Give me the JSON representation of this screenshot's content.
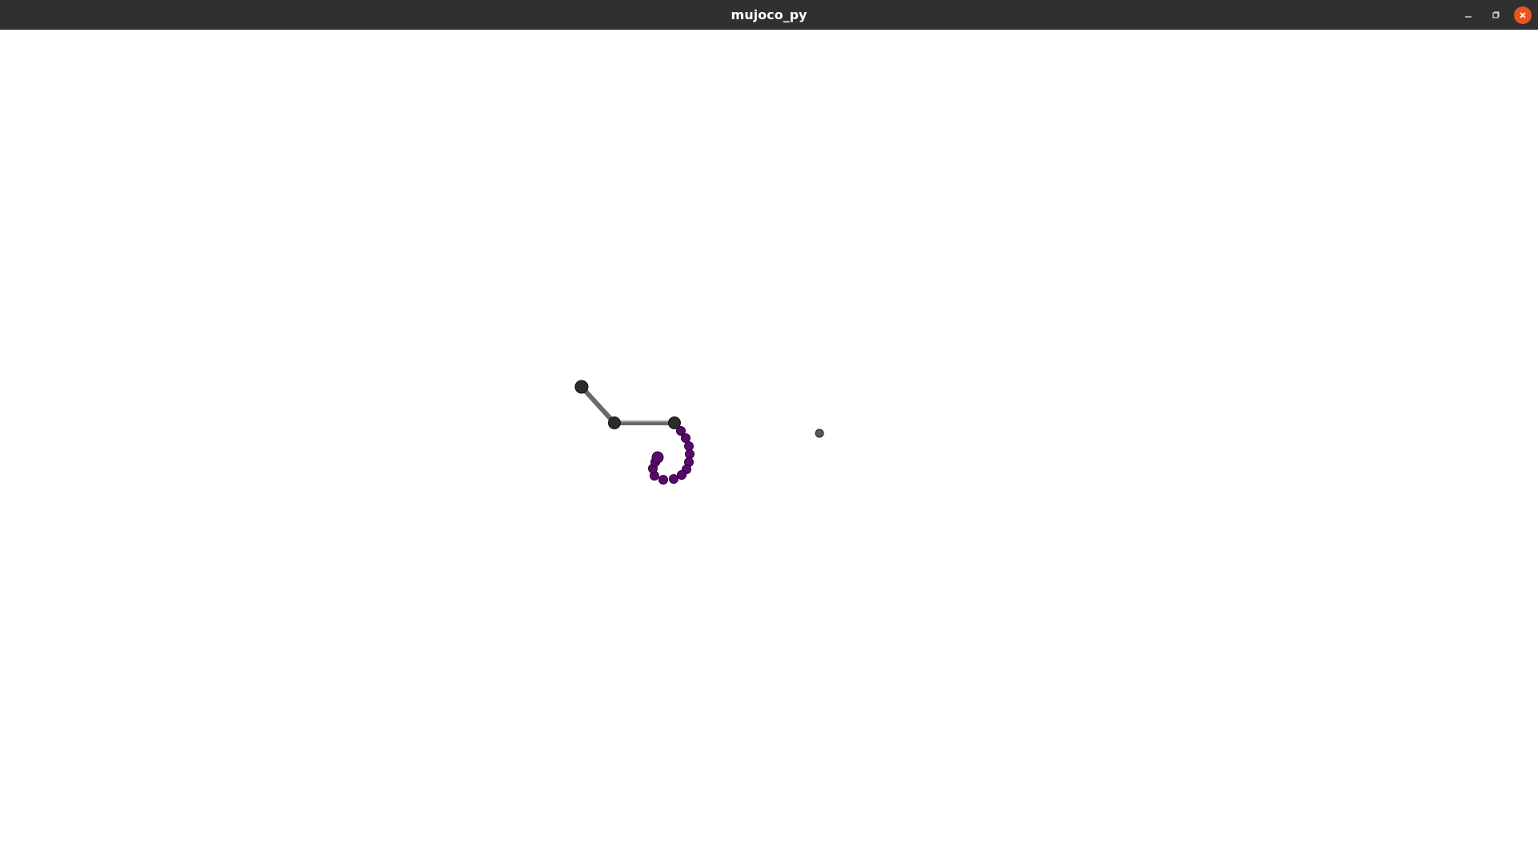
{
  "window": {
    "title": "mujoco_py",
    "controls": {
      "minimize_icon": "minimize-icon",
      "maximize_icon": "maximize-icon",
      "close_icon": "close-icon",
      "close_color": "#e95420"
    }
  },
  "scene": {
    "background": "#ffffff",
    "arm_color": "#2b2b2b",
    "rope_color": "#5a0a6e",
    "target_color": "#5a5a5a"
  }
}
